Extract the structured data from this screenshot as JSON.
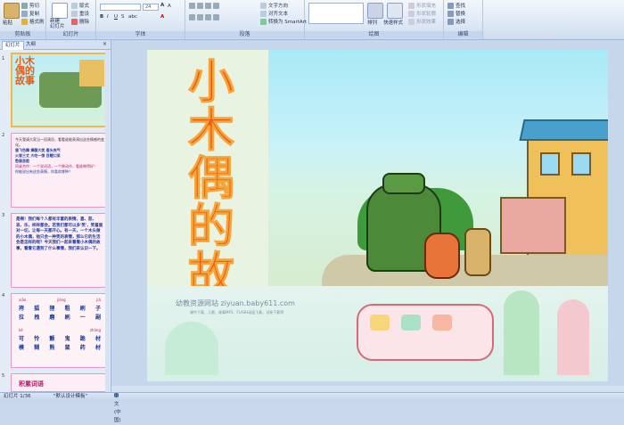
{
  "ribbon": {
    "clipboard": {
      "paste": "粘贴",
      "cut": "剪切",
      "copy": "复制",
      "format_painter": "格式刷",
      "label": "剪贴板"
    },
    "slides": {
      "new_slide": "新建\n幻灯片",
      "layout": "版式",
      "reset": "重设",
      "delete": "删除",
      "label": "幻灯片"
    },
    "font": {
      "font_size": "24",
      "label": "字体"
    },
    "paragraph": {
      "text_direction": "文字方向",
      "align_text": "对齐文本",
      "smartart": "转换为 SmartArt",
      "label": "段落"
    },
    "drawing": {
      "arrange": "排列",
      "quick_styles": "快速样式",
      "shape_fill": "形状填充",
      "shape_outline": "形状轮廓",
      "shape_effects": "形状效果",
      "label": "绘图"
    },
    "editing": {
      "find": "查找",
      "replace": "替换",
      "select": "选择",
      "label": "编辑"
    }
  },
  "panel": {
    "tabs": [
      "幻灯片",
      "大纲"
    ],
    "slide_numbers": [
      "1",
      "2",
      "3",
      "4",
      "5"
    ],
    "thumb1_title": "小木偶的故事",
    "thumb2_lines": [
      "今天我请大家当一回演员，看看谁能表演出这些情感的变化。",
      "眉飞色舞 捧腹大笑 垂头丧气",
      "火冒三丈 大吃一惊 目瞪口呆",
      "愁眉苦脸",
      "同桌合作：一个说词语，一个做动作，看谁做得好！",
      "你能说出有这些表情，你喜欢哪种？"
    ],
    "thumb3_text": "是啊！我们每个人都有丰富的表情，喜、怒、哀、乐，样样都会。若我们都可以多'笑'，笑着面对一切，让每一天都开心。有一天，一个木头做的小木偶，他只会一种笑的表情，那么它的生活会是怎样的呢？今天我们一起来看看小木偶的故事，看看它遇到了什么事情，我们来认识一下。",
    "thumb4_rows": [
      [
        "xiāo",
        "jiàng",
        "jiǎ"
      ],
      [
        "挎",
        "狐",
        "狸",
        "粗",
        "刷",
        "子"
      ],
      [
        "拉",
        "拽",
        "磨",
        "刷",
        "一",
        "副"
      ],
      [
        "kě",
        "",
        "zhǎng"
      ],
      [
        "可",
        "怜",
        "颤",
        "鬼",
        "跪",
        "材"
      ],
      [
        "模",
        "糊",
        "熊",
        "鼠",
        "药",
        "材"
      ]
    ],
    "thumb5_title": "积累词语"
  },
  "slide": {
    "title": "小木偶的故事",
    "watermark_main": "幼教资源网站 ziyuan.baby611.com",
    "watermark_sub": "课件下载、儿歌、故事MP3、FLASH动画下载、试卷下载等"
  },
  "status": {
    "slide_pos": "幻灯片 1/36",
    "theme": "\"默认设计模板\"",
    "language": "中文(中国)"
  },
  "colors": {
    "title": "#ee5a10",
    "accent": "#f1b74a"
  }
}
